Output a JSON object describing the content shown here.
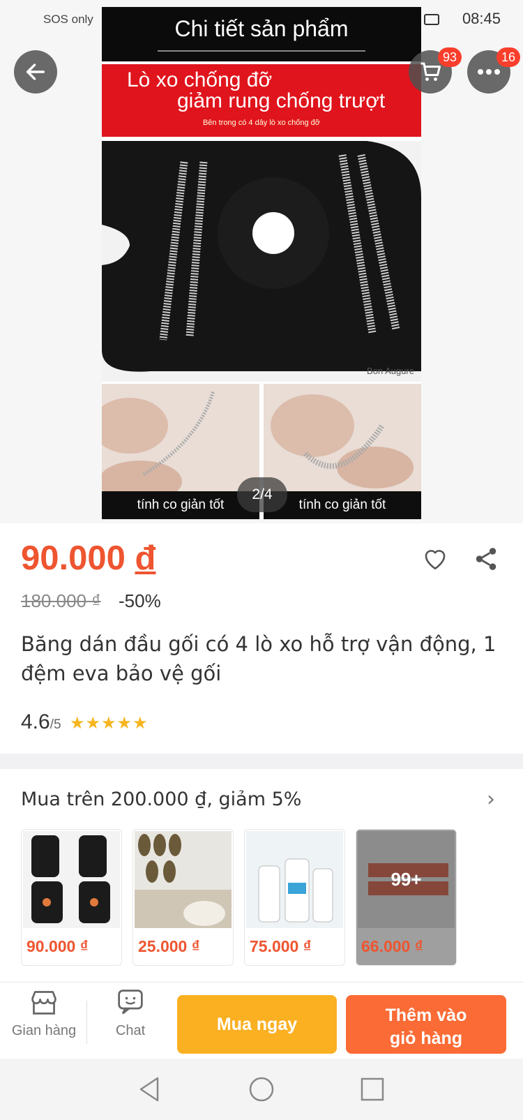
{
  "status_bar": {
    "carrier": "SOS only",
    "time": "08:45"
  },
  "header": {
    "cart_badge": "93",
    "more_badge": "16"
  },
  "gallery": {
    "header_title": "Chi tiết sản phẩm",
    "banner_line1": "Lò xo chống đỡ",
    "banner_line2": "giảm rung chống trượt",
    "banner_line3": "Bên trong có 4 dây lò xo chống đỡ",
    "brand": "Bon Augure",
    "caption_left": "tính co giản tốt",
    "caption_right": "tính co giản tốt",
    "page_indicator": "2/4"
  },
  "product": {
    "price": "90.000",
    "currency": "đ",
    "original_price": "180.000 ₫",
    "discount": "-50%",
    "title": "Băng dán đầu gối có 4 lò xo hỗ trợ vận động, 1 đệm eva bảo vệ gối",
    "rating": "4.6",
    "rating_max": "/5",
    "stars": "★★★★★"
  },
  "promo": {
    "title": "Mua trên 200.000 ₫, giảm 5%",
    "items": [
      {
        "price": "90.000 ₫"
      },
      {
        "price": "25.000 ₫"
      },
      {
        "price": "75.000 ₫"
      },
      {
        "price": "66.000 ₫",
        "more": "99+"
      }
    ]
  },
  "bottom_bar": {
    "store_label": "Gian hàng",
    "chat_label": "Chat",
    "buy_now": "Mua ngay",
    "add_to_cart_line1": "Thêm vào",
    "add_to_cart_line2": "giỏ hàng"
  },
  "colors": {
    "accent": "#ee5530",
    "buy_now": "#fbb022",
    "add_to_cart": "#fa6b35",
    "badge": "#fa3e2c"
  }
}
